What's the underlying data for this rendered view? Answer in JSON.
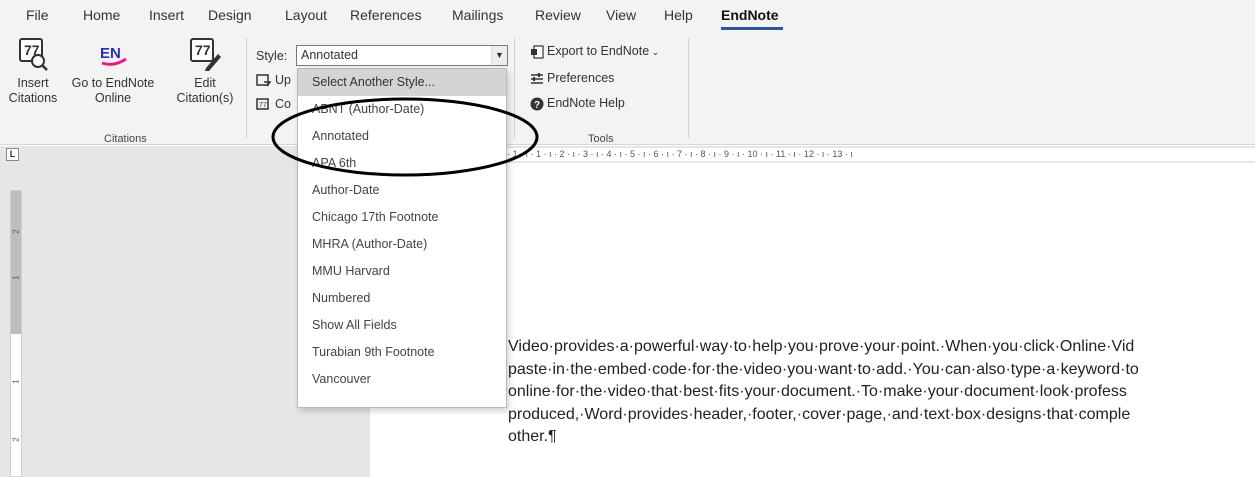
{
  "menu": {
    "items": [
      "File",
      "Home",
      "Insert",
      "Design",
      "Layout",
      "References",
      "Mailings",
      "Review",
      "View",
      "Help",
      "EndNote"
    ],
    "active": "EndNote",
    "accent": "#2b579a"
  },
  "ribbon": {
    "insert_citations": "Insert\nCitations",
    "go_to_online": "Go to EndNote\nOnline",
    "edit_citations": "Edit\nCitation(s)",
    "group_citations": "Citations",
    "style_label": "Style:",
    "style_value": "Annotated",
    "update_partial": "Up",
    "convert_partial": "Co",
    "export": "Export to EndNote",
    "preferences": "Preferences",
    "help": "EndNote Help",
    "group_tools": "Tools",
    "en_logo_text": "EN"
  },
  "dropdown": {
    "items": [
      "Select Another Style...",
      "ABNT (Author-Date)",
      "Annotated",
      "APA 6th",
      "Author-Date",
      "Chicago 17th Footnote",
      "MHRA (Author-Date)",
      "MMU Harvard",
      "Numbered",
      "Show All Fields",
      "Turabian 9th Footnote",
      "Vancouver"
    ],
    "highlighted": "Select Another Style..."
  },
  "ruler": {
    "tab_selector": "L",
    "marks": "· 1 · ı · 1 · ı · 2 · ı · 3 · ı · 4 · ı · 5 · ı · 6 · ı · 7 · ı · 8 · ı · 9 · ı · 10 · ı · 11 · ı · 12 · ı · 13 · ı",
    "vertical_numbers": [
      "2",
      "1",
      "1",
      "2"
    ]
  },
  "document": {
    "lines": [
      "Video·provides·a·powerful·way·to·help·you·prove·your·point.·When·you·click·Online·Vid",
      "paste·in·the·embed·code·for·the·video·you·want·to·add.·You·can·also·type·a·keyword·to",
      "online·for·the·video·that·best·fits·your·document.·To·make·your·document·look·profess",
      "produced,·Word·provides·header,·footer,·cover·page,·and·text·box·designs·that·comple",
      "other.¶"
    ]
  }
}
